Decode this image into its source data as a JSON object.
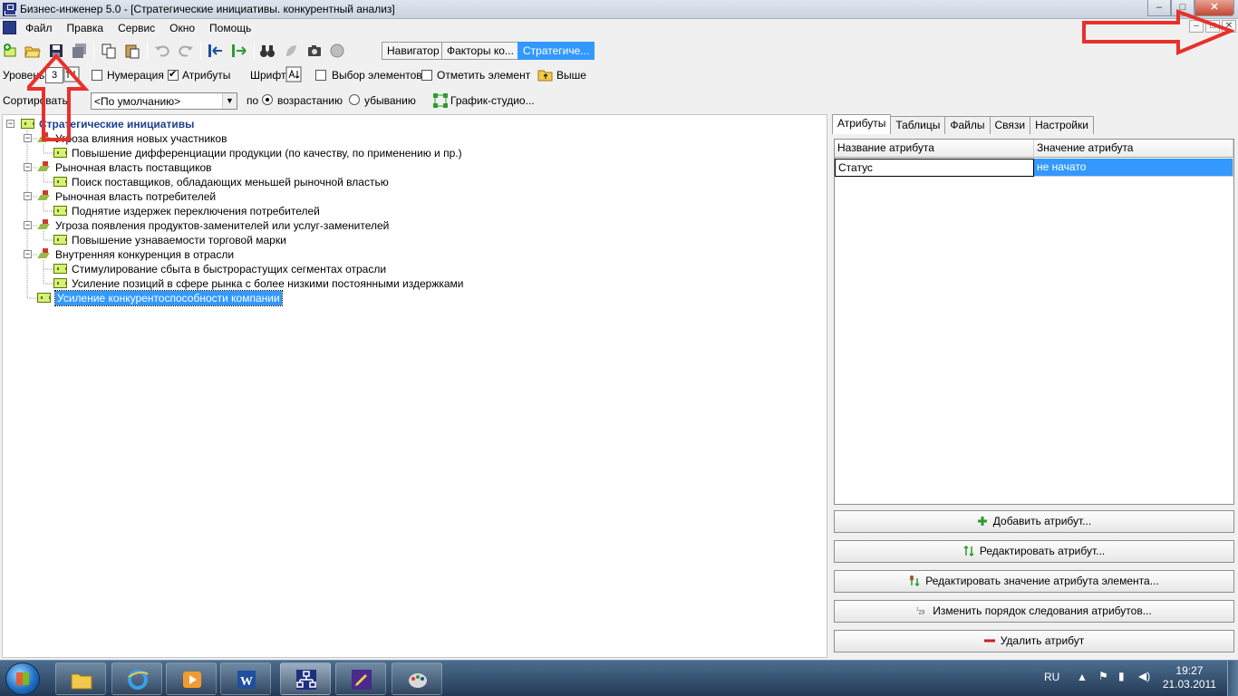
{
  "window": {
    "title": "Бизнес-инженер 5.0 - [Стратегические инициативы. конкурентный анализ]",
    "min": "‒",
    "max": "□",
    "close": "✕"
  },
  "menu": [
    "Файл",
    "Правка",
    "Сервис",
    "Окно",
    "Помощь"
  ],
  "nav_tabs": [
    {
      "label": "Навигатор",
      "active": false
    },
    {
      "label": "Факторы ко...",
      "active": false
    },
    {
      "label": "Стратегиче...",
      "active": true
    }
  ],
  "toolbar2": {
    "level_label": "Уровень",
    "level_value": "3",
    "numbering": {
      "label": "Нумерация",
      "checked": false
    },
    "attributes": {
      "label": "Атрибуты",
      "checked": true
    },
    "font_label": "Шрифт",
    "select_elements": {
      "label": "Выбор элементов",
      "checked": false
    },
    "mark_element": {
      "label": "Отметить элемент",
      "checked": false
    },
    "up_label": "Выше"
  },
  "toolbar3": {
    "sort_label": "Сортировать",
    "sort_value": "<По умолчанию>",
    "by_label": "по",
    "asc": {
      "label": "возрастанию",
      "checked": true
    },
    "desc": {
      "label": "убыванию",
      "checked": false
    },
    "graph_label": "График-студио..."
  },
  "tree": {
    "root": "Стратегические инициативы",
    "groups": [
      {
        "label": "Угроза влияния новых участников",
        "children": [
          "Повышение  дифференциации  продукции  (по качеству,  по применению и пр.)"
        ]
      },
      {
        "label": "Рыночная власть поставщиков",
        "children": [
          "Поиск поставщиков, обладающих  меньшей рыночной властью"
        ]
      },
      {
        "label": "Рыночная власть потребителей",
        "children": [
          "Поднятие издержек переключения потребителей"
        ]
      },
      {
        "label": "Угроза появления продуктов-заменителей или услуг-заменителей",
        "children": [
          "Повышение узнаваемости торговой марки"
        ]
      },
      {
        "label": "Внутренняя конкуренция в отрасли",
        "children": [
          "Стимулирование сбыта  в быстрорастущих сегментах отрасли",
          "Усиление позиций в сфере рынка  с более низкими постоянными издержками"
        ]
      }
    ],
    "selected": "Усиление   конкурентоспособности   компании"
  },
  "right_tabs": [
    {
      "label": "Атрибуты",
      "active": true
    },
    {
      "label": "Таблицы",
      "active": false
    },
    {
      "label": "Файлы",
      "active": false
    },
    {
      "label": "Связи",
      "active": false
    },
    {
      "label": "Настройки",
      "active": false
    }
  ],
  "attr_table": {
    "headers": [
      "Название атрибута",
      "Значение атрибута"
    ],
    "rows": [
      [
        "Статус",
        "не начато"
      ]
    ]
  },
  "attr_buttons": [
    {
      "label": "Добавить атрибут...",
      "icon": "plus-icon"
    },
    {
      "label": "Редактировать атрибут...",
      "icon": "edit-arrows-icon"
    },
    {
      "label": "Редактировать значение атрибута элемента...",
      "icon": "edit-value-icon"
    },
    {
      "label": "Изменить порядок следования атрибутов...",
      "icon": "order-123-icon"
    },
    {
      "label": "Удалить атрибут",
      "icon": "minus-icon"
    }
  ],
  "taskbar": {
    "lang": "RU",
    "time": "19:27",
    "date": "21.03.2011"
  },
  "colors": {
    "selection": "#3399ff",
    "annotation": "#e8302c",
    "tree_root": "#1f3f8f"
  }
}
